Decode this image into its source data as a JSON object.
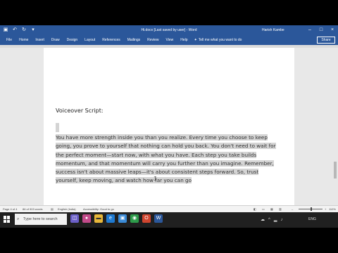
{
  "window": {
    "title": "Hi.docx [Last saved by user] - Word",
    "user": "Harish Kambe",
    "share": "Share"
  },
  "ribbon": {
    "tabs": [
      "File",
      "Home",
      "Insert",
      "Draw",
      "Design",
      "Layout",
      "References",
      "Mailings",
      "Review",
      "View",
      "Help"
    ],
    "tell_me": "Tell me what you want to do"
  },
  "document": {
    "heading": "Voiceover Script:",
    "paragraph": "You have more strength inside you than you realize. Every time you choose to keep going, you prove to yourself that nothing can hold you back. You don't need to wait for the perfect moment—start now, with what you have. Each step you take builds momentum, and that momentum will carry you further than you imagine. Remember, success isn't about massive leaps—it's about consistent steps forward. So, trust yourself, keep moving, and watch how far you can go"
  },
  "status": {
    "page": "Page 4 of 4",
    "words": "86 of 903 words",
    "language": "English (India)",
    "accessibility": "Accessibility: Good to go",
    "zoom": "110%"
  },
  "taskbar": {
    "search_placeholder": "Type here to search",
    "lang": "ENG"
  },
  "colors": {
    "word_blue": "#2b579a",
    "highlight": "#d4d4d4",
    "taskbar": "#202020"
  }
}
